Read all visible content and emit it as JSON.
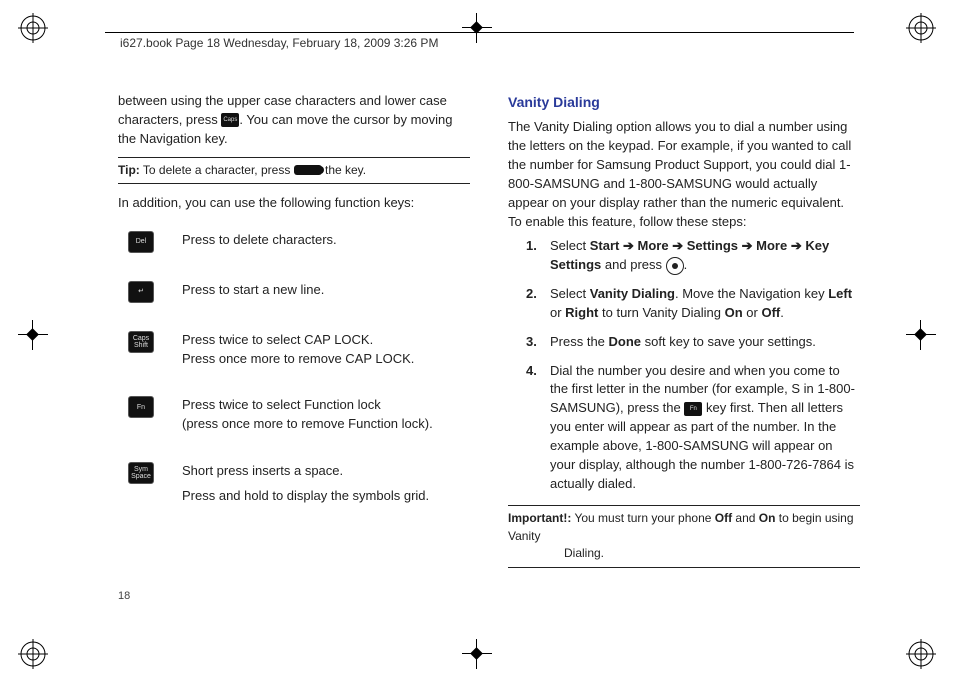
{
  "header": "i627.book  Page 18  Wednesday, February 18, 2009  3:26 PM",
  "page_number": "18",
  "left": {
    "intro_para": "between using the upper case characters and lower case characters, press ",
    "intro_para_after": ". You can move the cursor by moving the Navigation key.",
    "tip_label": "Tip:",
    "tip_text_before": " To delete a character, press ",
    "tip_text_after": " the key.",
    "addition": "In addition, you can use the following function keys:",
    "rows": {
      "r1_icon": "Del",
      "r1_desc": "Press to delete characters.",
      "r2_icon": "↵",
      "r2_desc": "Press to start a new line.",
      "r3_icon": "Caps Shift",
      "r3_desc1": "Press twice to select CAP LOCK.",
      "r3_desc2": "Press once more to remove CAP LOCK.",
      "r4_icon": "Fn",
      "r4_desc1": "Press twice to select Function lock",
      "r4_desc2": "(press once more to remove Function lock).",
      "r5_icon": "Sym Space",
      "r5_desc1": "Short press inserts a space.",
      "r5_desc2": "Press and hold to display the symbols grid."
    }
  },
  "right": {
    "heading": "Vanity Dialing",
    "intro": "The Vanity Dialing option allows you to dial a number using the letters on the keypad. For example, if you wanted to call the number for Samsung Product Support, you could dial 1-800-SAMSUNG and 1-800-SAMSUNG would actually appear on your display rather than the numeric equivalent. To enable this feature, follow these steps:",
    "s1_num": "1.",
    "s1a": "Select ",
    "s1_start": "Start",
    "s1_more1": "More",
    "s1_settings": "Settings",
    "s1_more2": "More",
    "s1_key": "Key Settings",
    "s1b": "and press ",
    "s1c": ".",
    "s2_num": "2.",
    "s2a": "Select ",
    "s2_vd": "Vanity Dialing",
    "s2b": ". Move the Navigation key ",
    "s2_left": "Left",
    "s2c": " or ",
    "s2_right": "Right",
    "s2d": " to turn Vanity Dialing ",
    "s2_on": "On",
    "s2e": " or ",
    "s2_off": "Off",
    "s2f": ".",
    "s3_num": "3.",
    "s3a": "Press the ",
    "s3_done": "Done",
    "s3b": " soft key to save your settings.",
    "s4_num": "4.",
    "s4a": "Dial the number you desire and when you come to the first letter in the number (for example, S in 1-800-SAMSUNG), press the ",
    "s4b": " key first. Then all letters you enter will appear as part of the number. In the example above, 1-800-SAMSUNG will appear on your display, although the number 1-800-726-7864 is actually dialed.",
    "imp_label": "Important!:",
    "imp_a": " You must turn your phone ",
    "imp_off": "Off",
    "imp_b": " and ",
    "imp_on": "On",
    "imp_c": " to begin using Vanity ",
    "imp_d": "Dialing."
  }
}
